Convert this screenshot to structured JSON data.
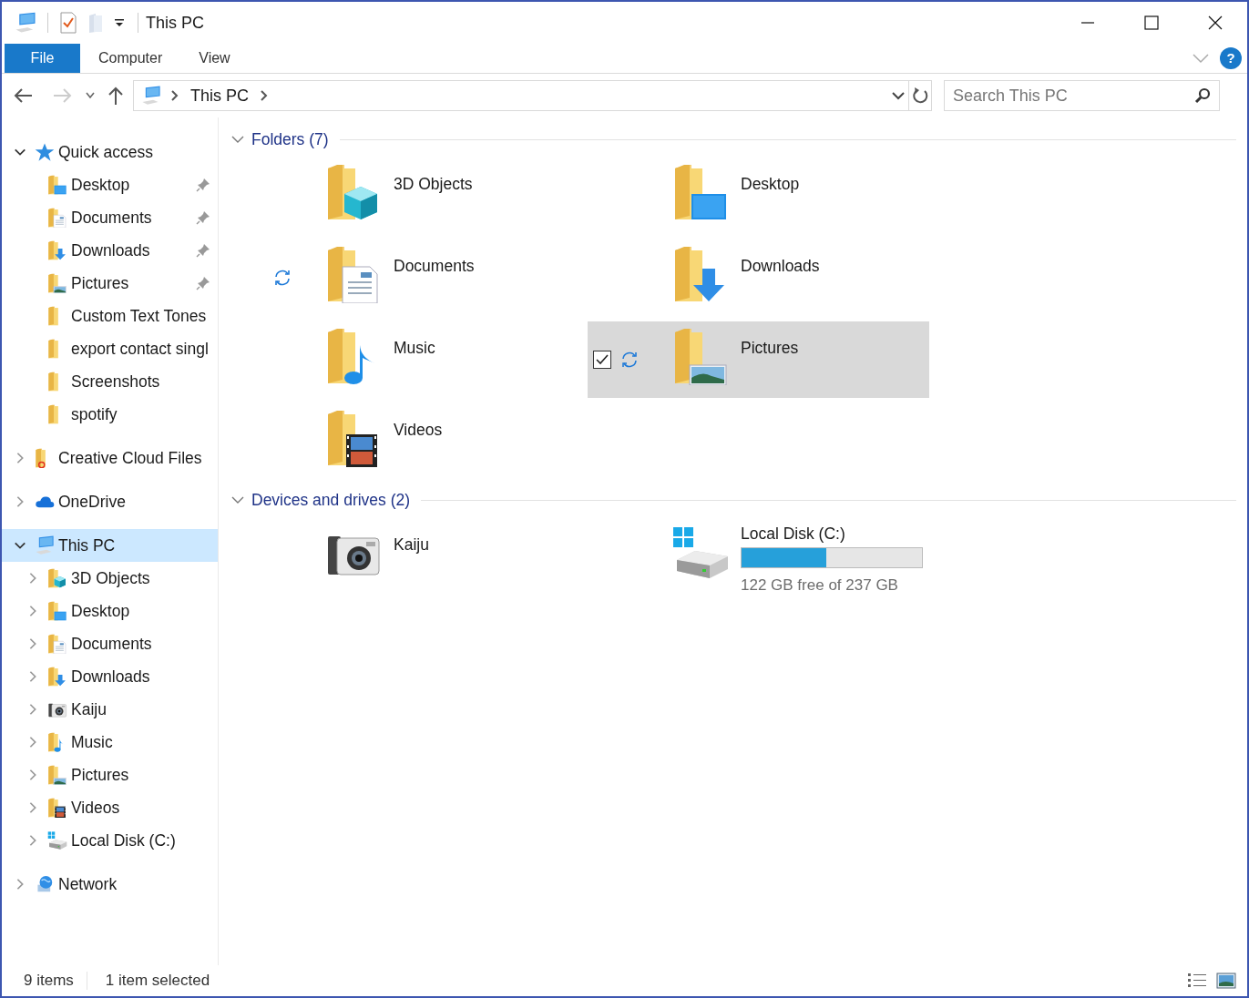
{
  "window": {
    "title": "This PC"
  },
  "ribbon": {
    "tabs": [
      {
        "label": "File",
        "selected": true
      },
      {
        "label": "Computer",
        "selected": false
      },
      {
        "label": "View",
        "selected": false
      }
    ],
    "help": "?"
  },
  "address": {
    "path": [
      "This PC"
    ],
    "search_placeholder": "Search This PC"
  },
  "navigation": [
    {
      "label": "Quick access",
      "kind": "star",
      "expanded": true,
      "selected": false,
      "children": [
        {
          "label": "Desktop",
          "kind": "desktop",
          "pinned": true,
          "selected": false
        },
        {
          "label": "Documents",
          "kind": "documents",
          "pinned": true,
          "selected": false
        },
        {
          "label": "Downloads",
          "kind": "downloads",
          "pinned": true,
          "selected": false
        },
        {
          "label": "Pictures",
          "kind": "pictures",
          "pinned": true,
          "selected": false
        },
        {
          "label": "Custom Text Tones",
          "kind": "folder",
          "pinned": false,
          "selected": false
        },
        {
          "label": "export contact singl",
          "kind": "folder",
          "pinned": false,
          "selected": false
        },
        {
          "label": "Screenshots",
          "kind": "folder",
          "pinned": false,
          "selected": false
        },
        {
          "label": "spotify",
          "kind": "folder",
          "pinned": false,
          "selected": false
        }
      ]
    },
    {
      "label": "Creative Cloud Files",
      "kind": "cc",
      "expanded": false,
      "selected": false
    },
    {
      "label": "OneDrive",
      "kind": "cloud",
      "expanded": false,
      "selected": false
    },
    {
      "label": "This PC",
      "kind": "pc",
      "expanded": true,
      "selected": true,
      "children": [
        {
          "label": "3D Objects",
          "kind": "objects",
          "expanded": false,
          "selected": false
        },
        {
          "label": "Desktop",
          "kind": "desktop",
          "expanded": false,
          "selected": false
        },
        {
          "label": "Documents",
          "kind": "documents",
          "expanded": false,
          "selected": false
        },
        {
          "label": "Downloads",
          "kind": "downloads",
          "expanded": false,
          "selected": false
        },
        {
          "label": "Kaiju",
          "kind": "camera",
          "expanded": false,
          "selected": false
        },
        {
          "label": "Music",
          "kind": "music",
          "expanded": false,
          "selected": false
        },
        {
          "label": "Pictures",
          "kind": "pictures",
          "expanded": false,
          "selected": false
        },
        {
          "label": "Videos",
          "kind": "videos",
          "expanded": false,
          "selected": false
        },
        {
          "label": "Local Disk (C:)",
          "kind": "drive",
          "expanded": false,
          "selected": false
        }
      ]
    },
    {
      "label": "Network",
      "kind": "network",
      "expanded": false,
      "selected": false
    }
  ],
  "sections": [
    {
      "title": "Folders (7)",
      "expanded": true,
      "items": [
        {
          "label": "3D Objects",
          "kind": "objects",
          "sync": false,
          "selected": false
        },
        {
          "label": "Desktop",
          "kind": "desktop",
          "sync": false,
          "selected": false
        },
        {
          "label": "Documents",
          "kind": "documents",
          "sync": true,
          "selected": false
        },
        {
          "label": "Downloads",
          "kind": "downloads",
          "sync": false,
          "selected": false
        },
        {
          "label": "Music",
          "kind": "music",
          "sync": false,
          "selected": false
        },
        {
          "label": "Pictures",
          "kind": "pictures",
          "sync": true,
          "selected": true
        },
        {
          "label": "Videos",
          "kind": "videos",
          "sync": false,
          "selected": false
        }
      ]
    },
    {
      "title": "Devices and drives (2)",
      "expanded": true,
      "items": [
        {
          "label": "Kaiju",
          "kind": "camera",
          "sync": false,
          "selected": false
        },
        {
          "label": "Local Disk (C:)",
          "kind": "drive",
          "sync": false,
          "selected": false,
          "level": 0.47,
          "free": "122 GB free of 237 GB"
        }
      ]
    }
  ],
  "status_bar": {
    "count": "9 items",
    "selection": "1 item selected"
  }
}
